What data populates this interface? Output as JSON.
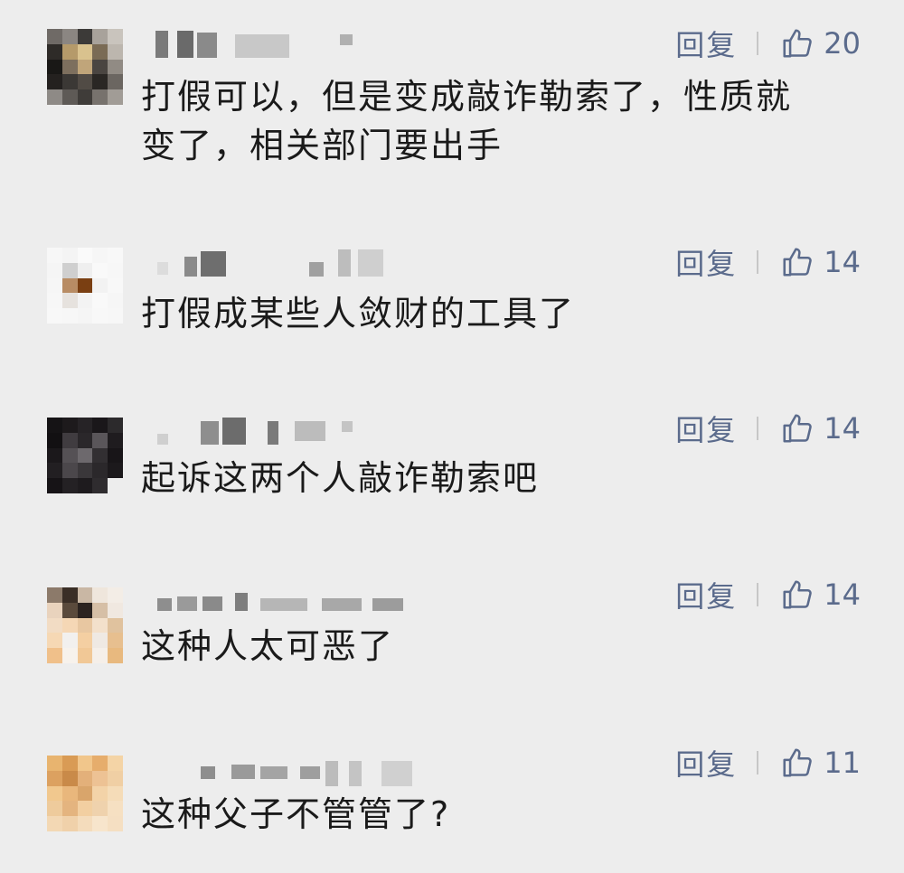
{
  "comments": [
    {
      "text": "打假可以，但是变成敲诈勒索了，性质就\n变了，相关部门要出手",
      "reply_label": "回复",
      "likes": "20",
      "avatar_colors": [
        "#6f6a66",
        "#8b8682",
        "#3c3a38",
        "#a8a29b",
        "#c9c4bd",
        "#2e2b28",
        "#b59a6a",
        "#d9c28e",
        "#7a6b55",
        "#bcb6ae",
        "#191816",
        "#7d6f5e",
        "#c0a57a",
        "#4a4541",
        "#918b84",
        "#24211f",
        "#3b3835",
        "#514b45",
        "#2a2724",
        "#6b6661",
        "#8e8a86",
        "#5e5a56",
        "#3f3c39",
        "#77726d",
        "#a19c96"
      ]
    },
    {
      "text": "打假成某些人敛财的工具了",
      "reply_label": "回复",
      "likes": "14",
      "avatar_colors": [
        "#f7f7f7",
        "#f4f4f4",
        "#fafafa",
        "#f6f6f6",
        "#f8f8f8",
        "#f5f5f5",
        "#cfcfcf",
        "#efefef",
        "#f9f9f9",
        "#f7f7f7",
        "#f6f6f6",
        "#b88c64",
        "#7a3f12",
        "#f2f2f2",
        "#f8f8f8",
        "#f7f7f7",
        "#e6e2de",
        "#f3f3f3",
        "#f9f9f9",
        "#f6f6f6",
        "#f8f8f8",
        "#f7f7f7",
        "#f5f5f5",
        "#f8f8f8",
        "#f7f7f7"
      ]
    },
    {
      "text": "起诉这两个人敲诈勒索吧",
      "reply_label": "回复",
      "likes": "14",
      "avatar_colors": [
        "#151315",
        "#1d1a1c",
        "#262326",
        "#1a171a",
        "#2c2a2c",
        "#121012",
        "#403c40",
        "#2a272a",
        "#5a565a",
        "#1f1c1f",
        "#1b181b",
        "#555155",
        "#6d696d",
        "#322f32",
        "#181518",
        "#221f22",
        "#4b474b",
        "#3a373a",
        "#2b282b",
        "#1c191c",
        "#161316",
        "#242124",
        "#1e1b1e",
        "#2f2c2f",
        "#ededed"
      ]
    },
    {
      "text": "这种人太可恶了",
      "reply_label": "回复",
      "likes": "14",
      "avatar_colors": [
        "#8c7a6a",
        "#3a2e26",
        "#c9b7a4",
        "#efe6dc",
        "#f3ede6",
        "#e9d3bd",
        "#5a4a3c",
        "#2b2320",
        "#d6bfa6",
        "#f0e8e0",
        "#f2dcc4",
        "#f5d7b5",
        "#e8c7a1",
        "#f3e0cb",
        "#e0c29e",
        "#f6d8b4",
        "#f2f0ee",
        "#f4cfa2",
        "#efe9e3",
        "#e7bf8f",
        "#f0c08a",
        "#f7f2ec",
        "#f1c896",
        "#f5efe9",
        "#e8b97f"
      ]
    },
    {
      "text": "这种父子不管管了?",
      "reply_label": "回复",
      "likes": "11",
      "avatar_colors": [
        "#e8b46f",
        "#d99b55",
        "#f1c68b",
        "#e6ad6c",
        "#f4d4a6",
        "#dca160",
        "#c98a49",
        "#e3b07a",
        "#edc294",
        "#f0cfa4",
        "#f1c88e",
        "#e9b77c",
        "#d9a56b",
        "#f3d3a8",
        "#f5dcb8",
        "#eecb9c",
        "#e4b47f",
        "#f2cfa1",
        "#efd2ad",
        "#f6e0c2",
        "#f3d8b4",
        "#f0d1aa",
        "#f4dcbc",
        "#f7e5cc",
        "#f5dfc2"
      ]
    }
  ]
}
